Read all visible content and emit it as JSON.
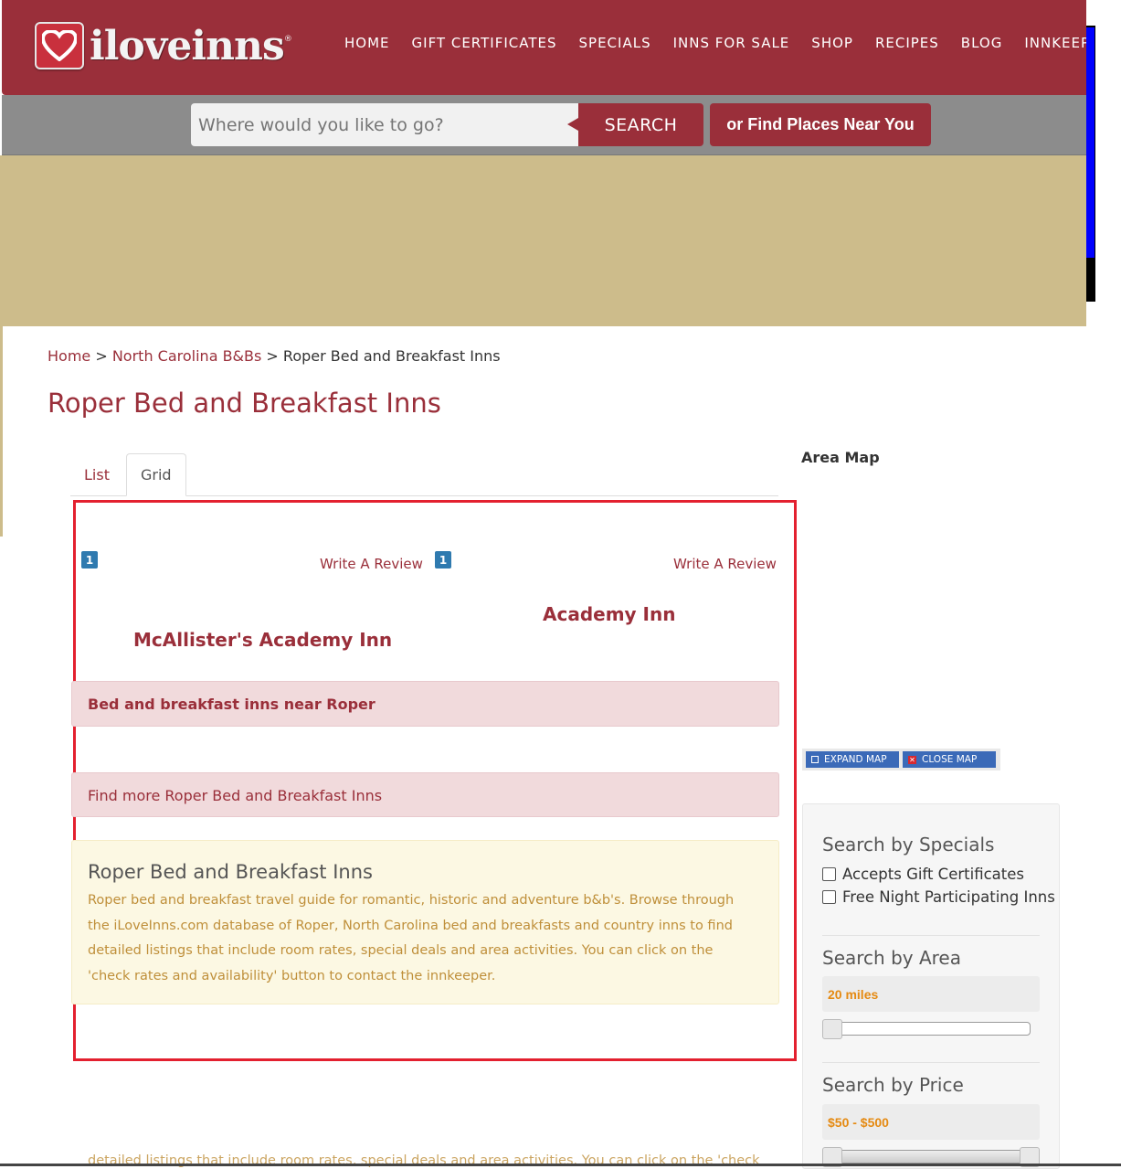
{
  "header": {
    "logo_text": "iloveinns",
    "logo_reg": "®",
    "nav": [
      "HOME",
      "GIFT CERTIFICATES",
      "SPECIALS",
      "INNS FOR SALE",
      "SHOP",
      "RECIPES",
      "BLOG",
      "INNKEEPERS"
    ]
  },
  "search": {
    "placeholder": "Where would you like to go?",
    "button_label": "SEARCH",
    "near_label": "or Find Places Near You"
  },
  "breadcrumb": {
    "home": "Home",
    "sep1": " > ",
    "state": "North Carolina B&Bs",
    "sep2": " > ",
    "current": "Roper Bed and Breakfast Inns"
  },
  "page_title": "Roper Bed and Breakfast Inns",
  "tabs": [
    "List",
    "Grid"
  ],
  "listings": [
    {
      "number": "1",
      "review_label": "Write A Review",
      "name": "McAllister's Academy Inn"
    },
    {
      "number": "1",
      "review_label": "Write A Review",
      "name": "Academy Inn"
    }
  ],
  "panels": {
    "near_heading": "Bed and breakfast inns near Roper",
    "find_more": "Find more Roper Bed and Breakfast Inns"
  },
  "info": {
    "title": "Roper Bed and Breakfast Inns",
    "text": "Roper bed and breakfast travel guide for romantic, historic and adventure b&b's. Browse through the iLoveInns.com database of Roper, North Carolina bed and breakfasts and country inns to find detailed listings that include room rates, special deals and area activities. You can click on the 'check rates and availability' button to contact the innkeeper.",
    "faded_line": "detailed listings that include room rates, special deals and area activities. You can click on the 'check"
  },
  "sidebar": {
    "area_map_title": "Area Map",
    "expand_map": "EXPAND MAP",
    "close_map": "CLOSE MAP",
    "specials_heading": "Search by Specials",
    "specials": [
      "Accepts Gift Certificates",
      "Free Night Participating Inns"
    ],
    "area_heading": "Search by Area",
    "area_value": "20 miles",
    "price_heading": "Search by Price",
    "price_value": "$50 - $500"
  },
  "colors": {
    "brand": "#9a2f3a",
    "banner": "#cdbc8b",
    "highlight_box": "#e3202f",
    "slider_value": "#e58a12"
  }
}
